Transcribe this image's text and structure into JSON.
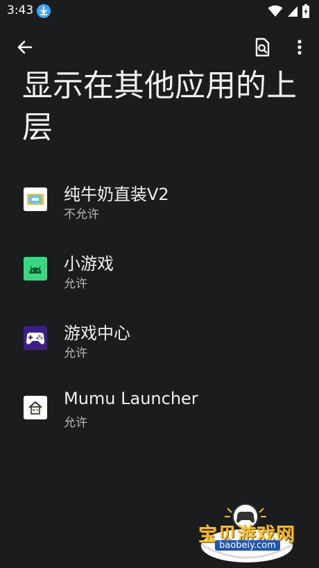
{
  "status_bar": {
    "time": "3:43"
  },
  "page": {
    "title": "显示在其他应用的上层"
  },
  "apps": [
    {
      "name": "纯牛奶直装V2",
      "status": "不允许",
      "icon": "milk-app-icon"
    },
    {
      "name": "小游戏",
      "status": "允许",
      "icon": "android-icon"
    },
    {
      "name": "游戏中心",
      "status": "允许",
      "icon": "gamepad-icon"
    },
    {
      "name": "Mumu Launcher",
      "status": "允许",
      "icon": "home-icon"
    }
  ],
  "watermark": {
    "text": "宝贝游戏网",
    "url": "baobeiy.com"
  },
  "colors": {
    "background": "#1b1c1e",
    "download_badge": "#3da5f4",
    "android_green": "#3ddc84"
  }
}
